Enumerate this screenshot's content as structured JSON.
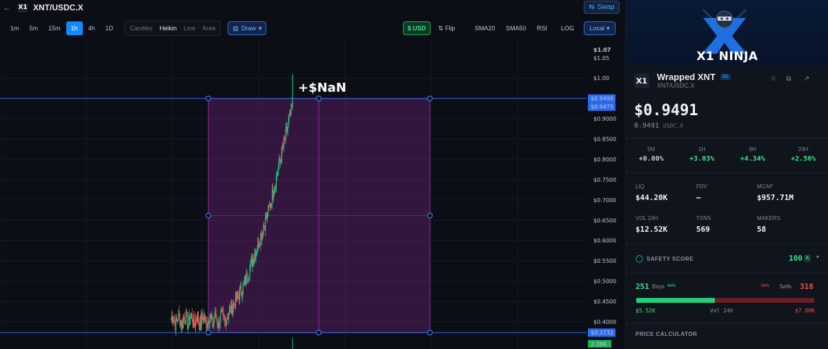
{
  "header": {
    "logo": "X1",
    "pair": "XNT/USDC.X",
    "swap_label": "Swap"
  },
  "toolbar": {
    "timeframes": [
      "1m",
      "5m",
      "15m",
      "1h",
      "4h",
      "1D"
    ],
    "active_timeframe": "1h",
    "chart_types": [
      "Candles",
      "Heikin",
      "Line",
      "Area"
    ],
    "active_chart_type": "Heikin",
    "draw_label": "Draw",
    "usd_label": "$ USD",
    "flip_label": "Flip",
    "sma20_label": "SMA20",
    "sma50_label": "SMA50",
    "rsi_label": "RSI",
    "log_label": "LOG",
    "local_label": "Local"
  },
  "chart": {
    "pnl_label": "+$NaN",
    "price_ticks": [
      "$1.07",
      "$1.05",
      "$1.00",
      "$0.9000",
      "$0.8500",
      "$0.8000",
      "$0.7500",
      "$0.7000",
      "$0.6500",
      "$0.6000",
      "$0.5500",
      "$0.5000",
      "$0.4500",
      "$0.4000"
    ],
    "tag_upper_line": "$0.9499",
    "tag_current": "$0.9475",
    "tag_lower_line": "$0.3732",
    "tag_volume": "2.36K",
    "colors": {
      "up": "#26c281",
      "down": "#ef4e4e",
      "box": "#8e2ba0",
      "line": "#2a6cf0"
    }
  },
  "chart_data": {
    "type": "candlestick",
    "yrange": [
      0.36,
      1.07
    ],
    "box_top": 0.9499,
    "box_bottom": 0.3732,
    "last_price": 0.9475
  },
  "banner": {
    "title": "X1 NINJA"
  },
  "token": {
    "logo": "X1",
    "name": "Wrapped XNT",
    "badge": "X1",
    "pair": "XNT/USDC.X",
    "price": "$0.9491",
    "price_native": "0.9491",
    "price_unit": "USDC.X"
  },
  "changes": [
    {
      "label": "5M",
      "value": "+0.00%",
      "color": "#c4c9d4"
    },
    {
      "label": "1H",
      "value": "+3.03%",
      "color": "#3fe08a"
    },
    {
      "label": "6H",
      "value": "+4.34%",
      "color": "#3fe08a"
    },
    {
      "label": "24H",
      "value": "+2.56%",
      "color": "#3fe08a"
    }
  ],
  "stats_row1": [
    {
      "label": "LIQ",
      "value": "$44.20K"
    },
    {
      "label": "FDV",
      "value": "—"
    },
    {
      "label": "MCAP",
      "value": "$957.71M"
    }
  ],
  "stats_row2": [
    {
      "label": "VOL 24H",
      "value": "$12.52K"
    },
    {
      "label": "TXNS",
      "value": "569"
    },
    {
      "label": "MAKERS",
      "value": "58"
    }
  ],
  "safety": {
    "label": "SAFETY SCORE",
    "score": "100",
    "grade": "A"
  },
  "trades": {
    "buys": "251",
    "buys_label": "Buys",
    "buys_pct": "44%",
    "sells": "318",
    "sells_label": "Sells",
    "sells_pct": "56%",
    "buy_ratio": 0.44,
    "vol_buy": "$5.52K",
    "vol_label": "Vol 24h",
    "vol_sell": "$7.00K"
  },
  "calculator": {
    "title": "PRICE CALCULATOR"
  }
}
